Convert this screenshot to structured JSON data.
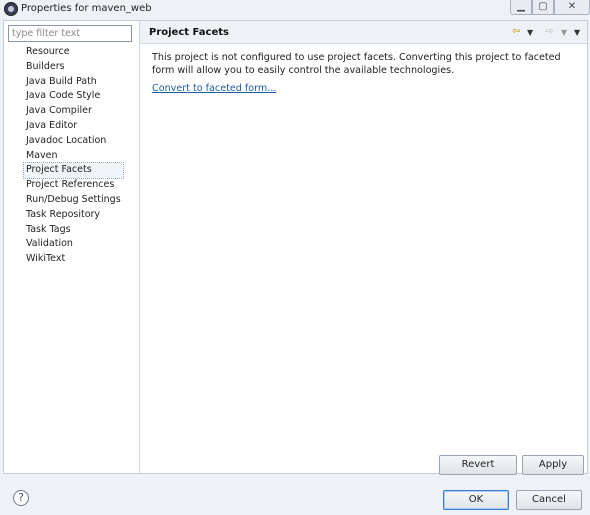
{
  "window": {
    "title": "Properties for maven_web"
  },
  "filter": {
    "placeholder": "type filter text"
  },
  "tree": {
    "items": [
      {
        "label": "Resource"
      },
      {
        "label": "Builders"
      },
      {
        "label": "Java Build Path"
      },
      {
        "label": "Java Code Style"
      },
      {
        "label": "Java Compiler"
      },
      {
        "label": "Java Editor"
      },
      {
        "label": "Javadoc Location"
      },
      {
        "label": "Maven"
      },
      {
        "label": "Project Facets",
        "selected": true
      },
      {
        "label": "Project References"
      },
      {
        "label": "Run/Debug Settings"
      },
      {
        "label": "Task Repository"
      },
      {
        "label": "Task Tags"
      },
      {
        "label": "Validation"
      },
      {
        "label": "WikiText"
      }
    ]
  },
  "page": {
    "title": "Project Facets",
    "message": "This project is not configured to use project facets. Converting this project to faceted form will allow you to easily control the available technologies.",
    "convert_link": "Convert to faceted form..."
  },
  "buttons": {
    "revert": "Revert",
    "apply": "Apply",
    "ok": "OK",
    "cancel": "Cancel",
    "help": "?"
  },
  "icons": {
    "back": "arrow-left-icon",
    "forward": "arrow-right-icon",
    "menu": "view-menu-icon",
    "help": "help-icon"
  },
  "colors": {
    "accent": "#3d7bd0",
    "link": "#1f5ba8"
  }
}
